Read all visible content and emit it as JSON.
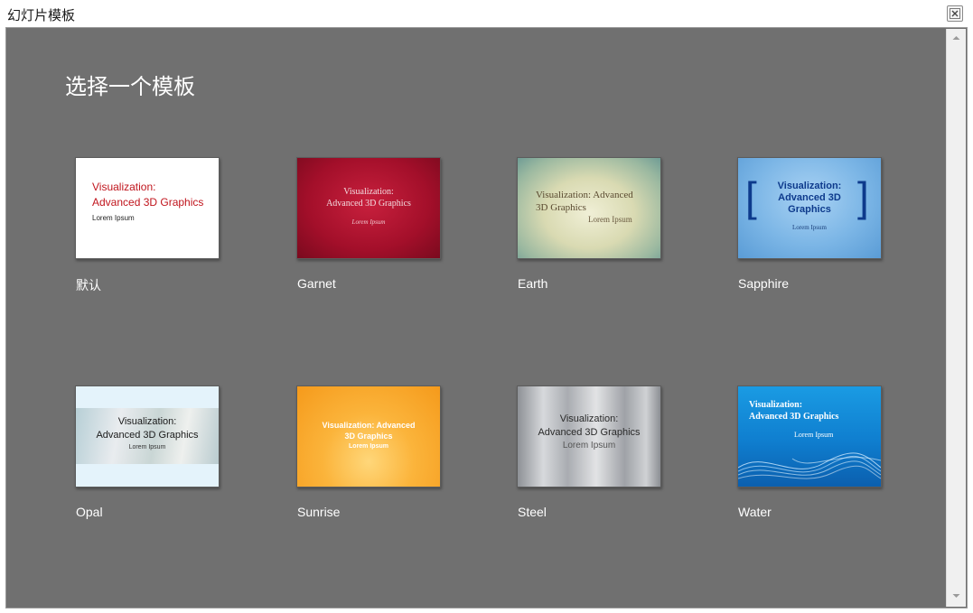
{
  "window": {
    "title": "幻灯片模板"
  },
  "heading": "选择一个模板",
  "templates": [
    {
      "name": "默认",
      "slide": {
        "title_line1": "Visualization:",
        "title_line2": "Advanced 3D Graphics",
        "subtitle": "Lorem Ipsum"
      }
    },
    {
      "name": "Garnet",
      "slide": {
        "title_line1": "Visualization:",
        "title_line2": "Advanced 3D Graphics",
        "subtitle": "Lorem Ipsum"
      }
    },
    {
      "name": "Earth",
      "slide": {
        "title_line1": "Visualization: Advanced",
        "title_line2": "3D Graphics",
        "subtitle": "Lorem Ipsum"
      }
    },
    {
      "name": "Sapphire",
      "slide": {
        "title_line1": "Visualization:",
        "title_line2": "Advanced 3D",
        "title_line3": "Graphics",
        "subtitle": "Lorem Ipsum"
      }
    },
    {
      "name": "Opal",
      "slide": {
        "title_line1": "Visualization:",
        "title_line2": "Advanced 3D Graphics",
        "subtitle": "Lorem Ipsum"
      }
    },
    {
      "name": "Sunrise",
      "slide": {
        "title_line1": "Visualization: Advanced",
        "title_line2": "3D Graphics",
        "subtitle": "Lorem Ipsum"
      }
    },
    {
      "name": "Steel",
      "slide": {
        "title_line1": "Visualization:",
        "title_line2": "Advanced 3D Graphics",
        "subtitle": "Lorem Ipsum"
      }
    },
    {
      "name": "Water",
      "slide": {
        "title_line1": "Visualization:",
        "title_line2": "Advanced 3D Graphics",
        "subtitle": "Lorem Ipsum"
      }
    }
  ],
  "colors": {
    "background": "#707070",
    "default_title": "#c0141c",
    "garnet": "#b5122f",
    "sapphire": "#6aace0",
    "sapphire_text": "#0d3a8c",
    "sunrise": "#f9a628",
    "water": "#0f7ecf"
  },
  "icons": {
    "close": "close-icon",
    "scroll_up": "scroll-up-arrow-icon",
    "scroll_down": "scroll-down-arrow-icon"
  }
}
